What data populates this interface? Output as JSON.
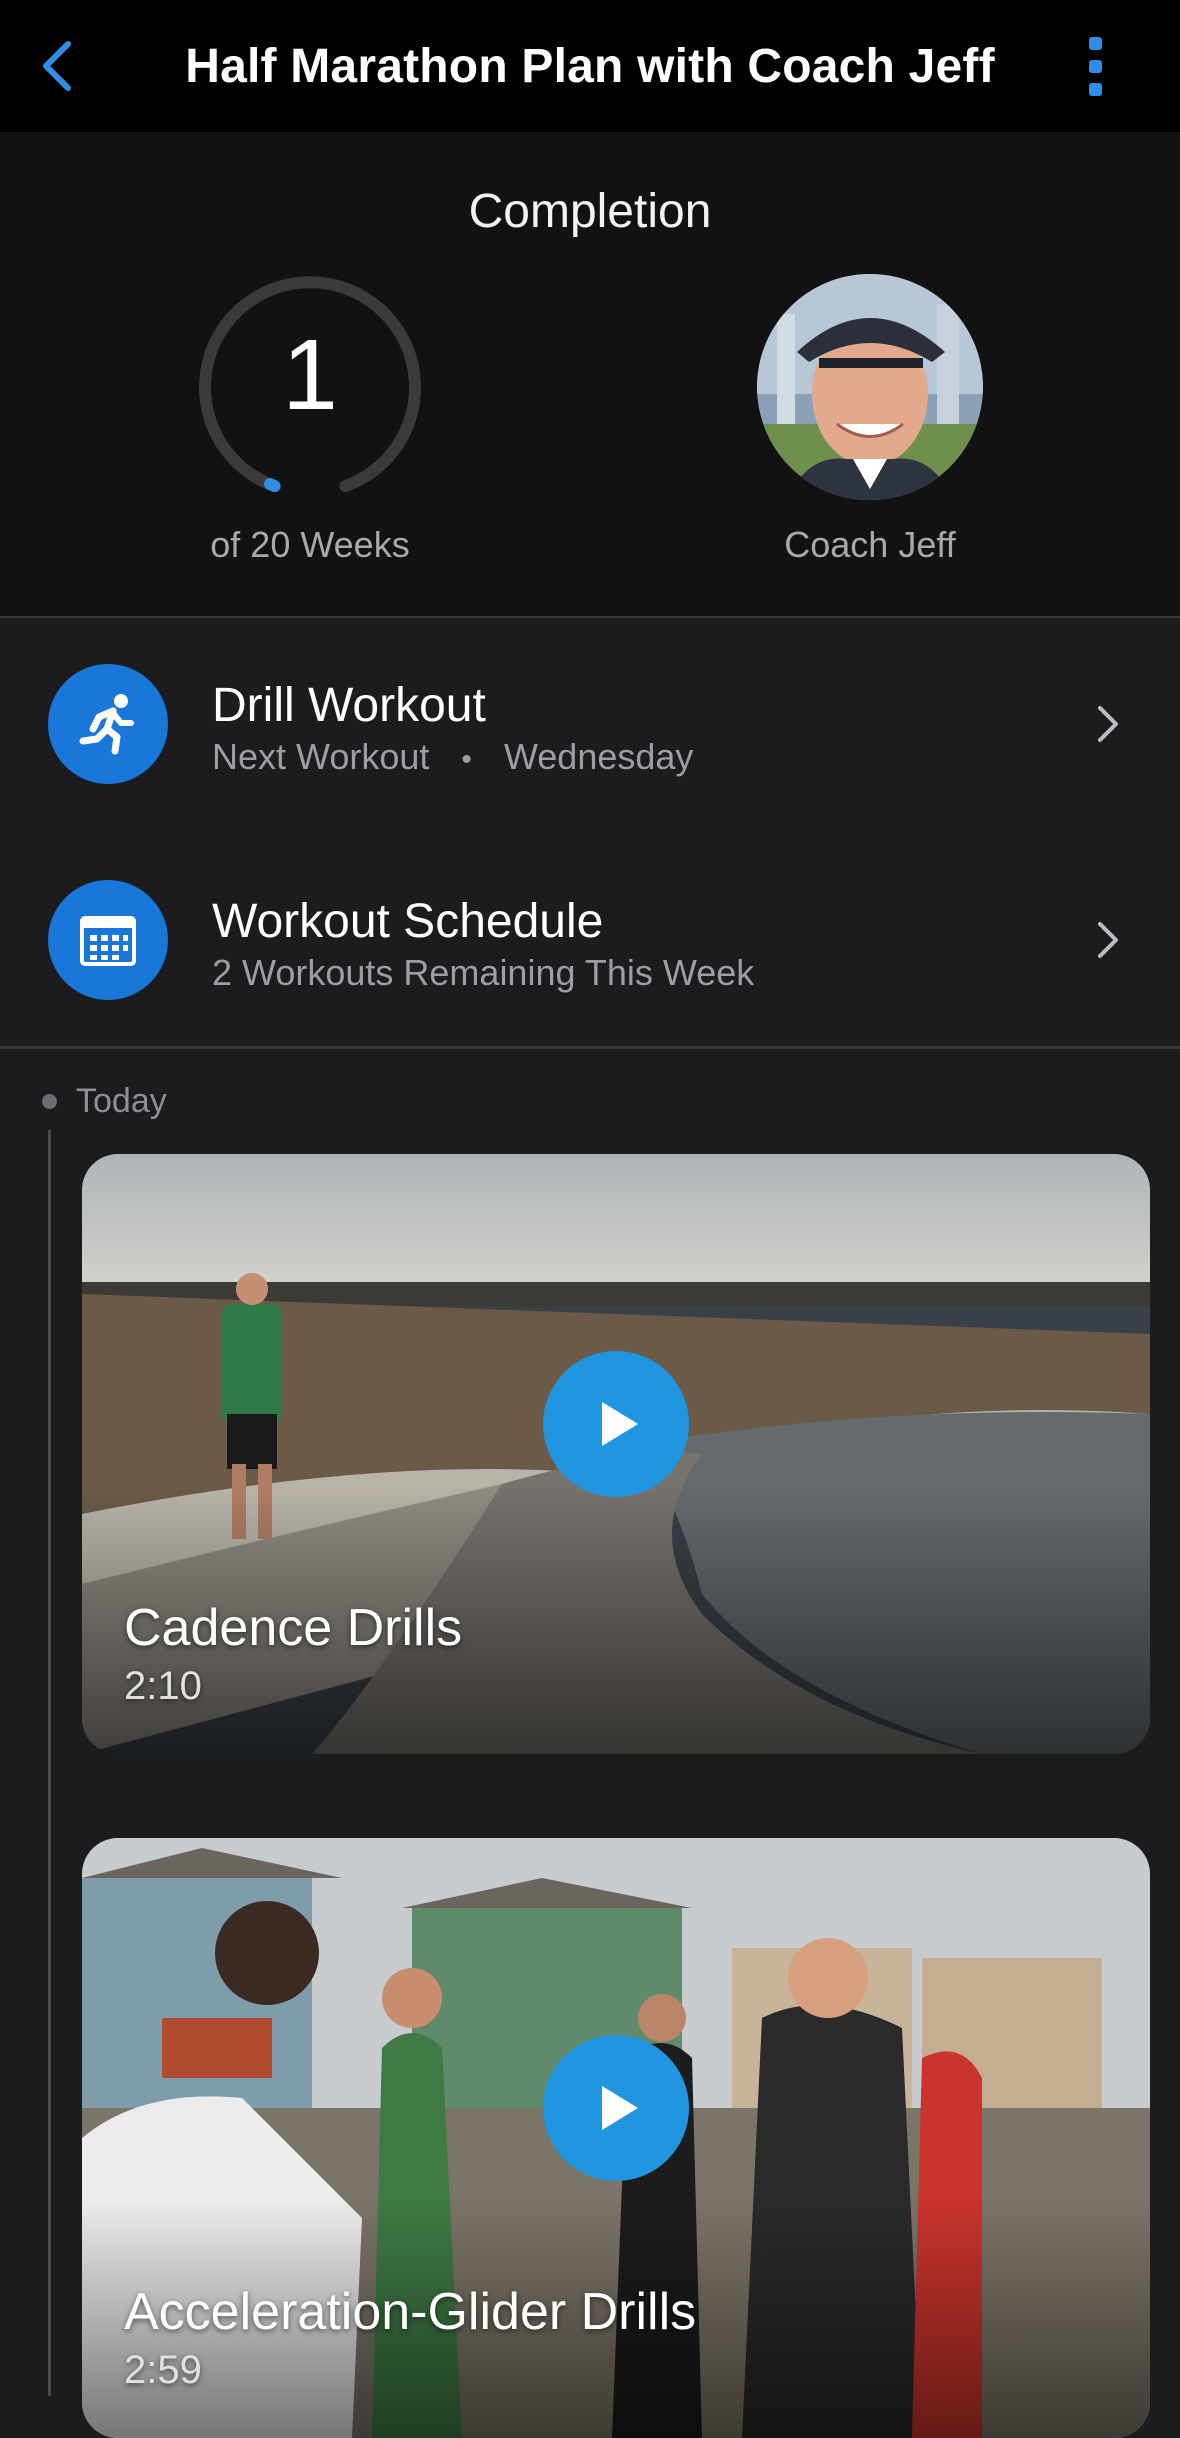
{
  "header": {
    "title": "Half Marathon Plan with Coach Jeff",
    "back_icon": "chevron-left-icon",
    "more_icon": "more-vertical-icon",
    "accent_color": "#2f8fe8"
  },
  "completion": {
    "heading": "Completion",
    "current_week": "1",
    "caption": "of 20 Weeks",
    "progress_fraction": 0.05,
    "coach_name": "Coach Jeff"
  },
  "rows": [
    {
      "icon": "running-person-icon",
      "title": "Drill Workout",
      "subtitle_left": "Next Workout",
      "subtitle_sep": "•",
      "subtitle_right": "Wednesday"
    },
    {
      "icon": "calendar-icon",
      "title": "Workout Schedule",
      "subtitle": "2 Workouts Remaining This Week"
    }
  ],
  "timeline": {
    "label": "Today",
    "videos": [
      {
        "title": "Cadence Drills",
        "duration": "2:10",
        "icon": "play-icon"
      },
      {
        "title": "Acceleration-Glider Drills",
        "duration": "2:59",
        "icon": "play-icon"
      }
    ]
  }
}
